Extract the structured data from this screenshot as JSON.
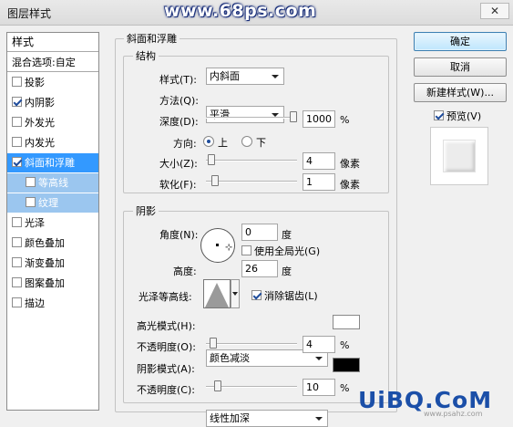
{
  "window": {
    "title": "图层样式",
    "close_glyph": "✕",
    "watermark_top": "www.68ps.com"
  },
  "left_panel": {
    "header": "样式",
    "blend": "混合选项:自定",
    "items": [
      {
        "label": "投影",
        "checked": false
      },
      {
        "label": "内阴影",
        "checked": true
      },
      {
        "label": "外发光",
        "checked": false
      },
      {
        "label": "内发光",
        "checked": false
      },
      {
        "label": "斜面和浮雕",
        "checked": true
      },
      {
        "label": "等高线",
        "checked": false
      },
      {
        "label": "纹理",
        "checked": false
      },
      {
        "label": "光泽",
        "checked": false
      },
      {
        "label": "颜色叠加",
        "checked": false
      },
      {
        "label": "渐变叠加",
        "checked": false
      },
      {
        "label": "图案叠加",
        "checked": false
      },
      {
        "label": "描边",
        "checked": false
      }
    ]
  },
  "bevel": {
    "title": "斜面和浮雕",
    "structure": {
      "title": "结构",
      "style_label": "样式(T):",
      "style_value": "内斜面",
      "technique_label": "方法(Q):",
      "technique_value": "平滑",
      "depth_label": "深度(D):",
      "depth_value": "1000",
      "depth_unit": "%",
      "depth_fraction": 1.0,
      "direction_label": "方向:",
      "dir_up": "上",
      "dir_down": "下",
      "size_label": "大小(Z):",
      "size_value": "4",
      "size_unit": "像素",
      "size_fraction": 0.02,
      "soften_label": "软化(F):",
      "soften_value": "1",
      "soften_unit": "像素",
      "soften_fraction": 0.06
    },
    "shading": {
      "title": "阴影",
      "angle_label": "角度(N):",
      "angle_value": "0",
      "angle_unit": "度",
      "global_light_label": "使用全局光(G)",
      "altitude_label": "高度:",
      "altitude_value": "26",
      "altitude_unit": "度",
      "gloss_label": "光泽等高线:",
      "antialias_label": "消除锯齿(L)",
      "highlight_mode_label": "高光模式(H):",
      "highlight_mode_value": "颜色减淡",
      "highlight_color": "#ffffff",
      "highlight_opacity_label": "不透明度(O):",
      "highlight_opacity_value": "4",
      "highlight_opacity_unit": "%",
      "highlight_opacity_fraction": 0.04,
      "shadow_mode_label": "阴影模式(A):",
      "shadow_mode_value": "线性加深",
      "shadow_color": "#000000",
      "shadow_opacity_label": "不透明度(C):",
      "shadow_opacity_value": "10",
      "shadow_opacity_unit": "%",
      "shadow_opacity_fraction": 0.1
    }
  },
  "buttons": {
    "ok": "确定",
    "cancel": "取消",
    "new_style": "新建样式(W)...",
    "preview": "预览(V)"
  },
  "watermark_bottom": {
    "main": "UiBQ.CoM",
    "url": "www.psahz.com"
  }
}
